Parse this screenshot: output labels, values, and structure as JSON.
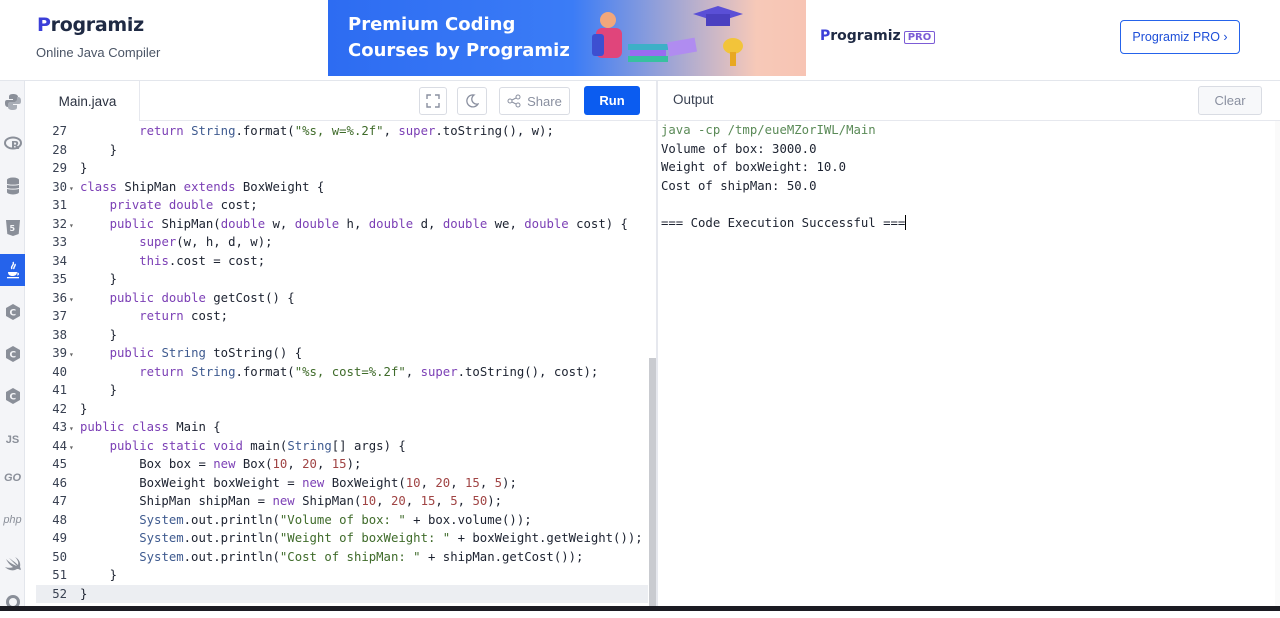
{
  "brand": {
    "name": "Programiz",
    "subtitle": "Online Java Compiler"
  },
  "ad": {
    "title_line1": "Premium Coding",
    "title_line2": "Courses by Programiz",
    "logo": "Programiz",
    "tag": "PRO"
  },
  "header": {
    "pro_button": "Programiz PRO ›"
  },
  "sidebar": {
    "icons": [
      "python-icon",
      "r-icon",
      "sql-icon",
      "html5-icon",
      "java-icon",
      "c-icon",
      "cpp-icon",
      "csharp-icon",
      "js-icon",
      "go-icon",
      "php-icon",
      "swift-icon",
      "rust-icon"
    ],
    "labels": {
      "js": "JS",
      "go": "GO",
      "php": "php"
    },
    "active": "java-icon",
    "accent": "#2563eb"
  },
  "editor": {
    "tab": "Main.java",
    "share_label": "Share",
    "run_label": "Run",
    "lines": [
      {
        "n": "27",
        "fold": "",
        "code": "        return String.format(\"%s, w=%.2f\", super.toString(), w);"
      },
      {
        "n": "28",
        "fold": "",
        "code": "    }"
      },
      {
        "n": "29",
        "fold": "",
        "code": "}"
      },
      {
        "n": "30",
        "fold": "▾",
        "code": "class ShipMan extends BoxWeight {"
      },
      {
        "n": "31",
        "fold": "",
        "code": "    private double cost;"
      },
      {
        "n": "32",
        "fold": "▾",
        "code": "    public ShipMan(double w, double h, double d, double we, double cost) {"
      },
      {
        "n": "33",
        "fold": "",
        "code": "        super(w, h, d, w);"
      },
      {
        "n": "34",
        "fold": "",
        "code": "        this.cost = cost;"
      },
      {
        "n": "35",
        "fold": "",
        "code": "    }"
      },
      {
        "n": "36",
        "fold": "▾",
        "code": "    public double getCost() {"
      },
      {
        "n": "37",
        "fold": "",
        "code": "        return cost;"
      },
      {
        "n": "38",
        "fold": "",
        "code": "    }"
      },
      {
        "n": "39",
        "fold": "▾",
        "code": "    public String toString() {"
      },
      {
        "n": "40",
        "fold": "",
        "code": "        return String.format(\"%s, cost=%.2f\", super.toString(), cost);"
      },
      {
        "n": "41",
        "fold": "",
        "code": "    }"
      },
      {
        "n": "42",
        "fold": "",
        "code": "}"
      },
      {
        "n": "43",
        "fold": "▾",
        "code": "public class Main {"
      },
      {
        "n": "44",
        "fold": "▾",
        "code": "    public static void main(String[] args) {"
      },
      {
        "n": "45",
        "fold": "",
        "code": "        Box box = new Box(10, 20, 15);"
      },
      {
        "n": "46",
        "fold": "",
        "code": "        BoxWeight boxWeight = new BoxWeight(10, 20, 15, 5);"
      },
      {
        "n": "47",
        "fold": "",
        "code": "        ShipMan shipMan = new ShipMan(10, 20, 15, 5, 50);"
      },
      {
        "n": "48",
        "fold": "",
        "code": "        System.out.println(\"Volume of box: \" + box.volume());"
      },
      {
        "n": "49",
        "fold": "",
        "code": "        System.out.println(\"Weight of boxWeight: \" + boxWeight.getWeight());"
      },
      {
        "n": "50",
        "fold": "",
        "code": "        System.out.println(\"Cost of shipMan: \" + shipMan.getCost());"
      },
      {
        "n": "51",
        "fold": "",
        "code": "    }"
      },
      {
        "n": "52",
        "fold": "",
        "code": "}"
      }
    ],
    "current_line": "52"
  },
  "output": {
    "label": "Output",
    "clear_label": "Clear",
    "command": "java -cp /tmp/eueMZorIWL/Main",
    "lines": [
      "Volume of box: 3000.0",
      "Weight of boxWeight: 10.0",
      "Cost of shipMan: 50.0",
      "",
      "=== Code Execution Successful ==="
    ]
  }
}
